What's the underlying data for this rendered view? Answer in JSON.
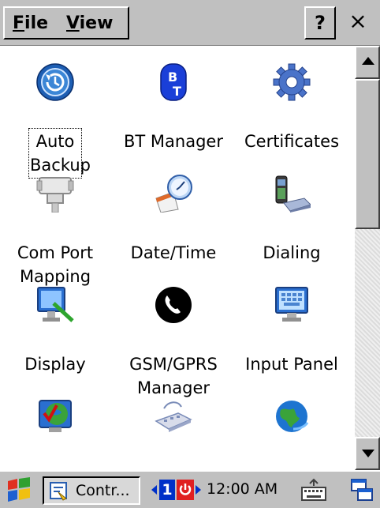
{
  "menubar": {
    "file": {
      "underline": "F",
      "rest": "ile"
    },
    "view": {
      "underline": "V",
      "rest": "iew"
    },
    "help": "?",
    "close": "×"
  },
  "items": [
    {
      "id": "auto-backup",
      "icon": "auto-backup-icon",
      "line1": "Auto",
      "line2": "Backup",
      "selected": true
    },
    {
      "id": "bt-manager",
      "icon": "bluetooth-icon",
      "line1": "BT Manager",
      "line2": ""
    },
    {
      "id": "certificates",
      "icon": "gear-icon",
      "line1": "Certificates",
      "line2": ""
    },
    {
      "id": "com-port-mapping",
      "icon": "serial-port-icon",
      "line1": "Com Port",
      "line2": "Mapping"
    },
    {
      "id": "date-time",
      "icon": "calendar-clock-icon",
      "line1": "Date/Time",
      "line2": ""
    },
    {
      "id": "dialing",
      "icon": "phone-modem-icon",
      "line1": "Dialing",
      "line2": ""
    },
    {
      "id": "display",
      "icon": "display-icon",
      "line1": "Display",
      "line2": ""
    },
    {
      "id": "gsm-gprs-manager",
      "icon": "phone-handset-icon",
      "line1": "GSM/GPRS",
      "line2": "Manager"
    },
    {
      "id": "input-panel",
      "icon": "input-panel-icon",
      "line1": "Input Panel",
      "line2": ""
    }
  ],
  "taskbar": {
    "task_label": "Contr...",
    "desktop_number": "1",
    "clock": "12:00 AM"
  }
}
